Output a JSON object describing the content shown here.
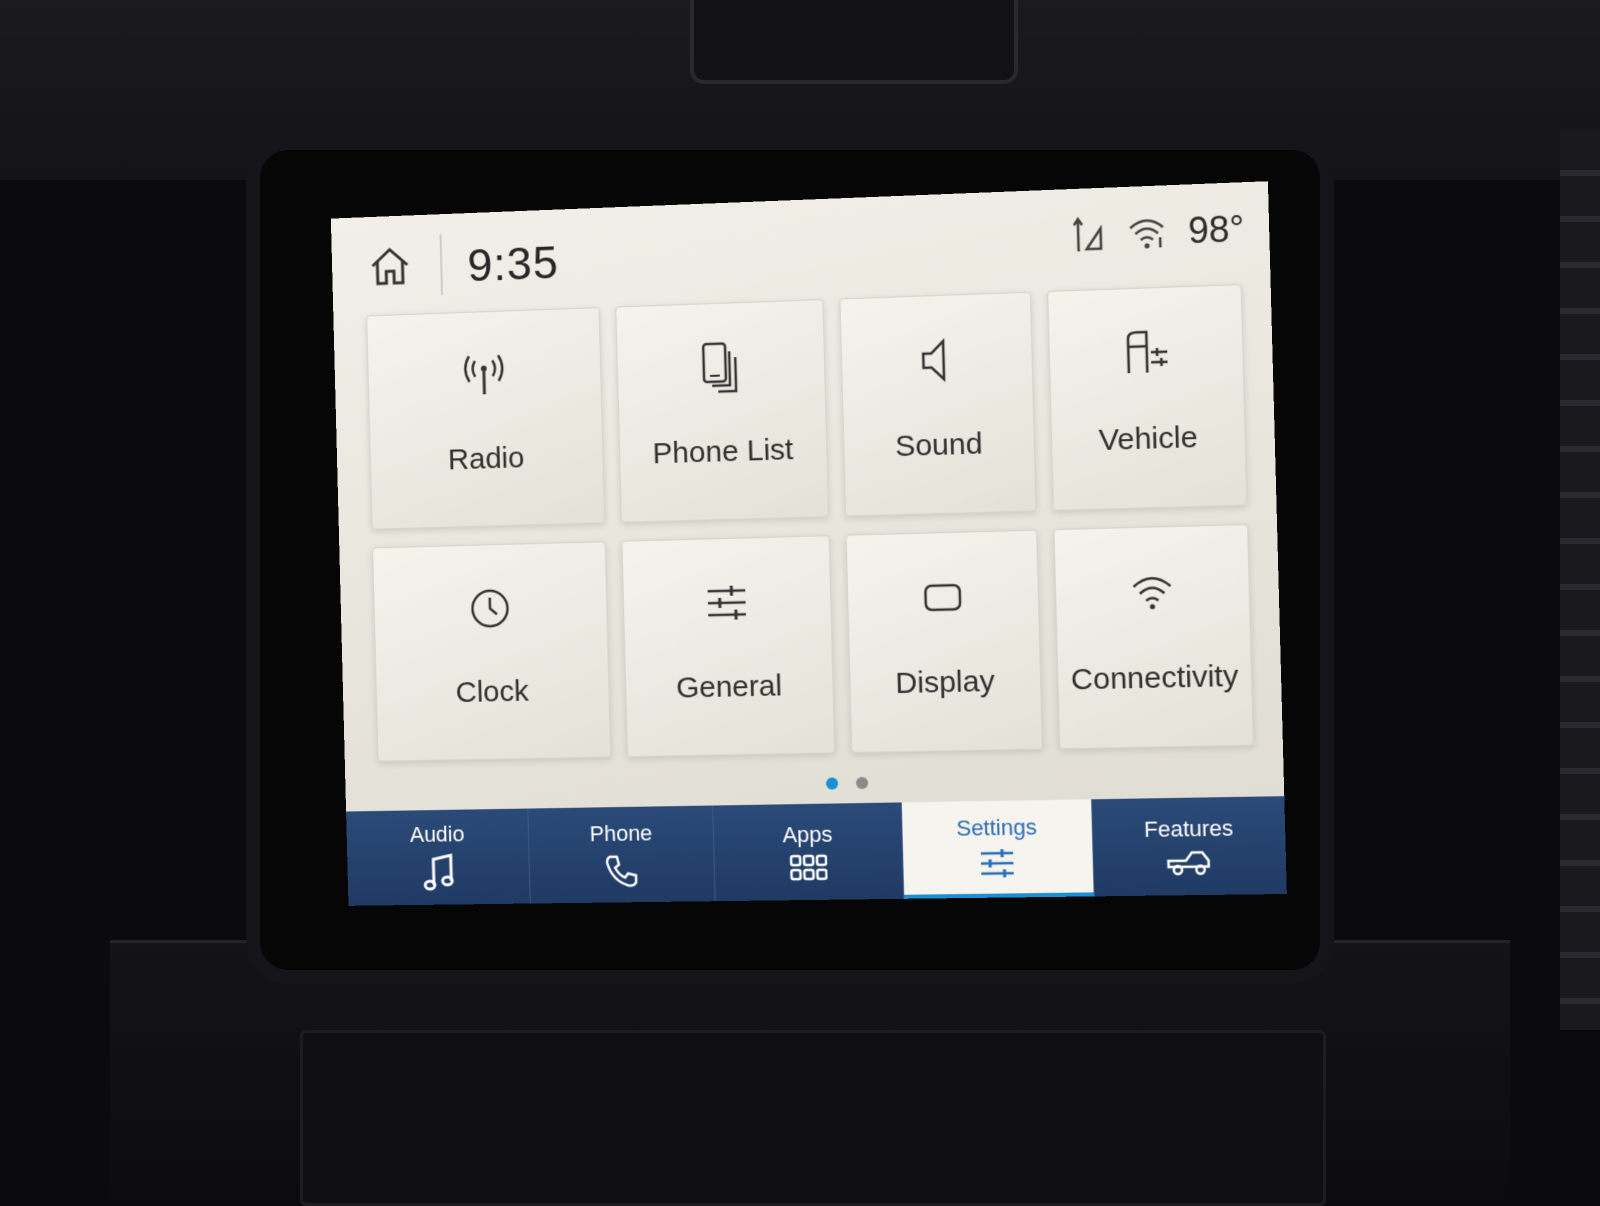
{
  "status_bar": {
    "time": "9:35",
    "temperature": "98°",
    "icons": [
      "home-icon",
      "gps-signal-icon",
      "wifi-hotspot-icon"
    ]
  },
  "tiles": [
    {
      "label": "Radio",
      "icon": "radio-antenna-icon"
    },
    {
      "label": "Phone List",
      "icon": "phone-list-icon"
    },
    {
      "label": "Sound",
      "icon": "speaker-icon"
    },
    {
      "label": "Vehicle",
      "icon": "vehicle-settings-icon"
    },
    {
      "label": "Clock",
      "icon": "clock-icon"
    },
    {
      "label": "General",
      "icon": "sliders-icon"
    },
    {
      "label": "Display",
      "icon": "display-icon"
    },
    {
      "label": "Connectivity",
      "icon": "wifi-icon"
    }
  ],
  "pagination": {
    "current": 1,
    "total": 2
  },
  "nav": [
    {
      "label": "Audio",
      "icon": "music-note-icon",
      "selected": false
    },
    {
      "label": "Phone",
      "icon": "phone-handset-icon",
      "selected": false
    },
    {
      "label": "Apps",
      "icon": "apps-grid-icon",
      "selected": false
    },
    {
      "label": "Settings",
      "icon": "settings-sliders-icon",
      "selected": true
    },
    {
      "label": "Features",
      "icon": "truck-icon",
      "selected": false
    }
  ],
  "colors": {
    "nav_bg": "#1f3a63",
    "accent": "#1a8fd6",
    "screen_bg": "#ebe8e0"
  }
}
